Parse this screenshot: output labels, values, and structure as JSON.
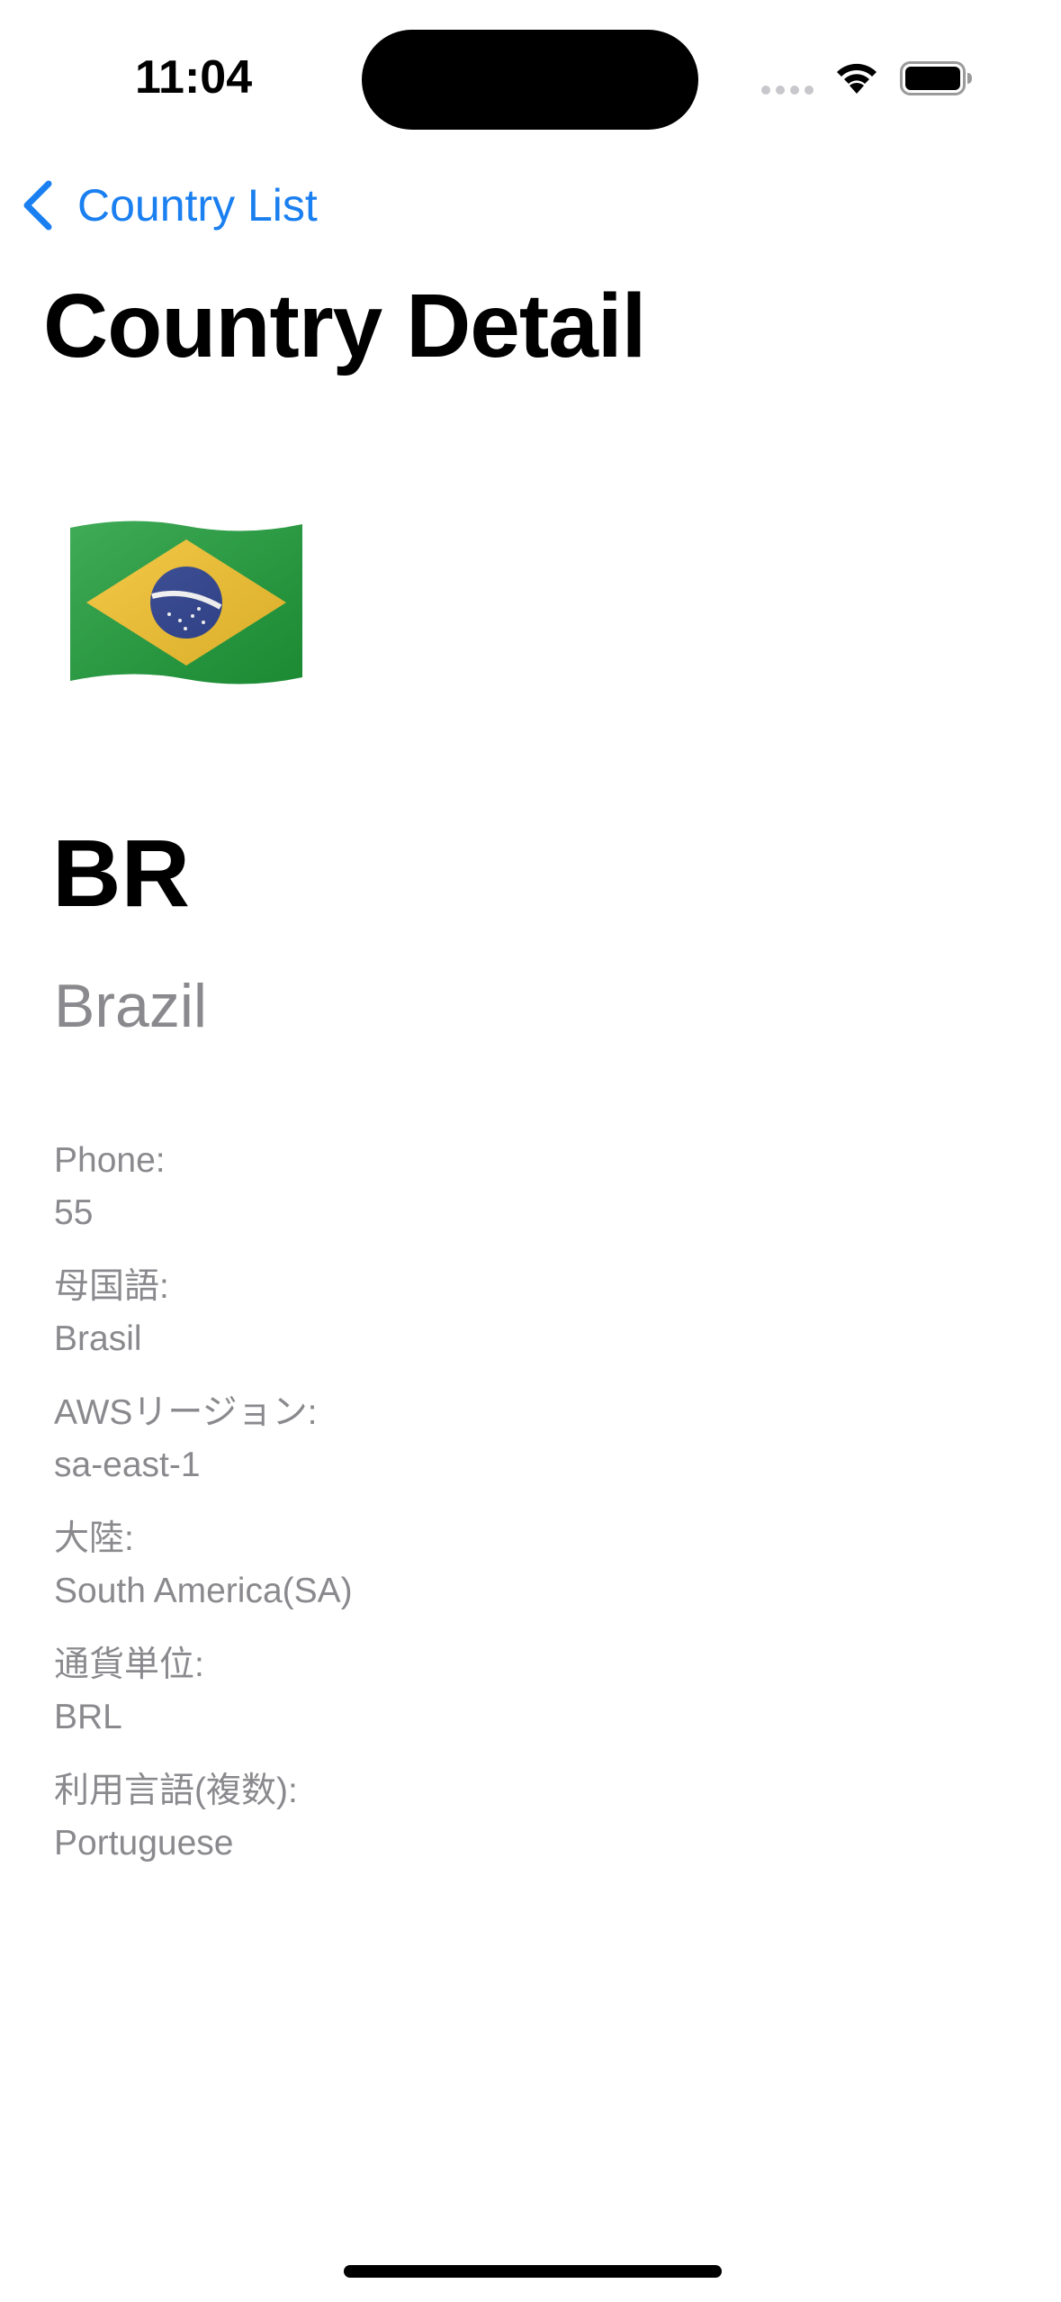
{
  "status_bar": {
    "time": "11:04"
  },
  "nav": {
    "back_label": "Country List"
  },
  "page": {
    "title": "Country Detail"
  },
  "country": {
    "flag_icon": "brazil-flag-icon",
    "code": "BR",
    "name": "Brazil",
    "details": [
      {
        "label": "Phone:",
        "value": "55"
      },
      {
        "label": "母国語:",
        "value": "Brasil"
      },
      {
        "label": "AWSリージョン:",
        "value": "sa-east-1"
      },
      {
        "label": "大陸:",
        "value": "South America(SA)"
      },
      {
        "label": "通貨単位:",
        "value": "BRL"
      },
      {
        "label": "利用言語(複数):",
        "value": "Portuguese"
      }
    ]
  },
  "colors": {
    "accent": "#1a7ff0",
    "secondary_text": "#8a8a8e",
    "flag_green": "#1f9d3a",
    "flag_yellow": "#f6c42d",
    "flag_blue": "#2b3f8f"
  }
}
